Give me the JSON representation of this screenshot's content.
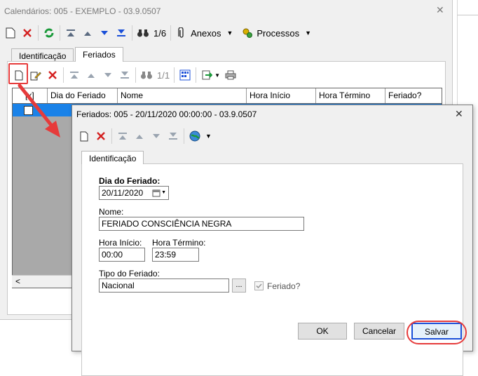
{
  "outer": {
    "title": "Calendários: 005 - EXEMPLO - 03.9.0507",
    "close": "✕",
    "toolbar": {
      "counter": "1/6",
      "attachments": "Anexos",
      "processes": "Processos"
    },
    "tabs": [
      {
        "label": "Identificação"
      },
      {
        "label": "Feriados"
      }
    ],
    "grid_toolbar": {
      "counter": "1/1"
    },
    "grid": {
      "columns": [
        "[x]",
        "Dia do Feriado",
        "Nome",
        "Hora Início",
        "Hora Término",
        "Feriado?"
      ],
      "scroll_left": "<"
    }
  },
  "dialog": {
    "title": "Feriados: 005 - 20/11/2020 00:00:00 - 03.9.0507",
    "close": "✕",
    "tab": "Identificação",
    "fields": {
      "dia_label": "Dia do Feriado:",
      "dia_value": "20/11/2020",
      "nome_label": "Nome:",
      "nome_value": "FERIADO CONSCIÊNCIA NEGRA",
      "hora_inicio_label": "Hora Início:",
      "hora_inicio_value": "00:00",
      "hora_termino_label": "Hora Término:",
      "hora_termino_value": "23:59",
      "tipo_label": "Tipo do Feriado:",
      "tipo_value": "Nacional",
      "lookup": "...",
      "feriado_check_label": "Feriado?"
    },
    "buttons": {
      "ok": "OK",
      "cancel": "Cancelar",
      "save": "Salvar"
    }
  },
  "colors": {
    "accent_row": "#1a82e8",
    "annotation": "#e63b3b",
    "refresh_green": "#1a9a3a",
    "delete_red": "#d42020"
  }
}
